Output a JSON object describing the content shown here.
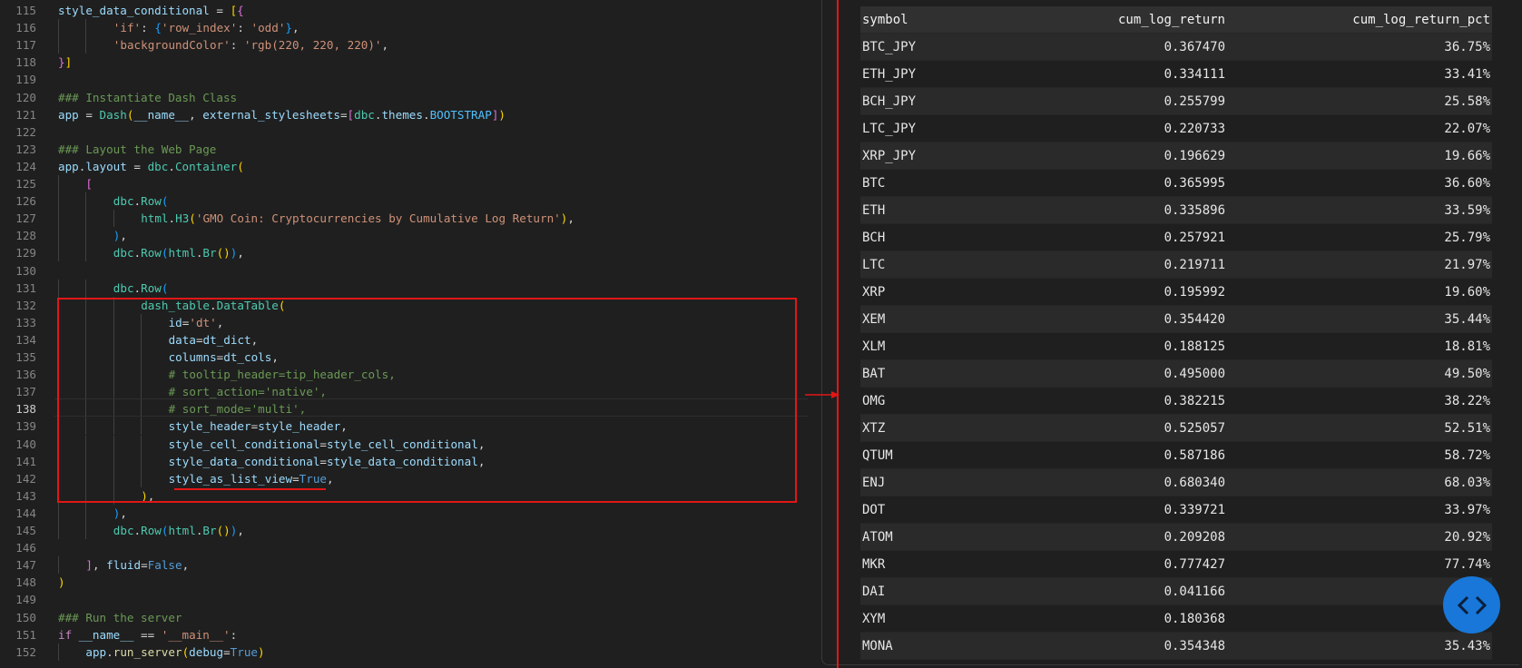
{
  "editor": {
    "lines": [
      {
        "n": "115",
        "tokens": [
          [
            "t-var",
            "style_data_conditional"
          ],
          [
            "t-op",
            " = "
          ],
          [
            "t-brk1",
            "["
          ],
          [
            "t-brk2",
            "{"
          ]
        ]
      },
      {
        "n": "116",
        "indent": 2,
        "tokens": [
          [
            "t-str",
            "'if'"
          ],
          [
            "t-op",
            ": "
          ],
          [
            "t-brk3",
            "{"
          ],
          [
            "t-str",
            "'row_index'"
          ],
          [
            "t-op",
            ": "
          ],
          [
            "t-str",
            "'odd'"
          ],
          [
            "t-brk3",
            "}"
          ],
          [
            "t-op",
            ","
          ]
        ]
      },
      {
        "n": "117",
        "indent": 2,
        "tokens": [
          [
            "t-str",
            "'backgroundColor'"
          ],
          [
            "t-op",
            ": "
          ],
          [
            "t-str",
            "'rgb(220, 220, 220)'"
          ],
          [
            "t-op",
            ","
          ]
        ]
      },
      {
        "n": "118",
        "tokens": [
          [
            "t-brk2",
            "}"
          ],
          [
            "t-brk1",
            "]"
          ]
        ]
      },
      {
        "n": "119",
        "tokens": []
      },
      {
        "n": "120",
        "tokens": [
          [
            "t-cmt",
            "### Instantiate Dash Class"
          ]
        ]
      },
      {
        "n": "121",
        "tokens": [
          [
            "t-var",
            "app"
          ],
          [
            "t-op",
            " = "
          ],
          [
            "t-cls",
            "Dash"
          ],
          [
            "t-brk1",
            "("
          ],
          [
            "t-var",
            "__name__"
          ],
          [
            "t-op",
            ", "
          ],
          [
            "t-var",
            "external_stylesheets"
          ],
          [
            "t-op",
            "="
          ],
          [
            "t-brk2",
            "["
          ],
          [
            "t-cls",
            "dbc"
          ],
          [
            "t-op",
            "."
          ],
          [
            "t-var",
            "themes"
          ],
          [
            "t-op",
            "."
          ],
          [
            "t-num",
            "BOOTSTRAP"
          ],
          [
            "t-brk2",
            "]"
          ],
          [
            "t-brk1",
            ")"
          ]
        ]
      },
      {
        "n": "122",
        "tokens": []
      },
      {
        "n": "123",
        "tokens": [
          [
            "t-cmt",
            "### Layout the Web Page"
          ]
        ]
      },
      {
        "n": "124",
        "tokens": [
          [
            "t-var",
            "app"
          ],
          [
            "t-op",
            "."
          ],
          [
            "t-var",
            "layout"
          ],
          [
            "t-op",
            " = "
          ],
          [
            "t-cls",
            "dbc"
          ],
          [
            "t-op",
            "."
          ],
          [
            "t-cls",
            "Container"
          ],
          [
            "t-brk1",
            "("
          ]
        ]
      },
      {
        "n": "125",
        "indent": 1,
        "tokens": [
          [
            "t-brk2",
            "["
          ]
        ]
      },
      {
        "n": "126",
        "indent": 2,
        "tokens": [
          [
            "t-cls",
            "dbc"
          ],
          [
            "t-op",
            "."
          ],
          [
            "t-cls",
            "Row"
          ],
          [
            "t-brk3",
            "("
          ]
        ]
      },
      {
        "n": "127",
        "indent": 3,
        "tokens": [
          [
            "t-cls",
            "html"
          ],
          [
            "t-op",
            "."
          ],
          [
            "t-cls",
            "H3"
          ],
          [
            "t-brk1",
            "("
          ],
          [
            "t-str",
            "'GMO Coin: Cryptocurrencies by Cumulative Log Return'"
          ],
          [
            "t-brk1",
            ")"
          ],
          [
            "t-op",
            ","
          ]
        ]
      },
      {
        "n": "128",
        "indent": 2,
        "tokens": [
          [
            "t-brk3",
            ")"
          ],
          [
            "t-op",
            ","
          ]
        ]
      },
      {
        "n": "129",
        "indent": 2,
        "tokens": [
          [
            "t-cls",
            "dbc"
          ],
          [
            "t-op",
            "."
          ],
          [
            "t-cls",
            "Row"
          ],
          [
            "t-brk3",
            "("
          ],
          [
            "t-cls",
            "html"
          ],
          [
            "t-op",
            "."
          ],
          [
            "t-cls",
            "Br"
          ],
          [
            "t-brk1",
            "()"
          ],
          [
            "t-brk3",
            ")"
          ],
          [
            "t-op",
            ","
          ]
        ]
      },
      {
        "n": "130",
        "tokens": []
      },
      {
        "n": "131",
        "indent": 2,
        "tokens": [
          [
            "t-cls",
            "dbc"
          ],
          [
            "t-op",
            "."
          ],
          [
            "t-cls",
            "Row"
          ],
          [
            "t-brk3",
            "("
          ]
        ]
      },
      {
        "n": "132",
        "indent": 3,
        "tokens": [
          [
            "t-cls",
            "dash_table"
          ],
          [
            "t-op",
            "."
          ],
          [
            "t-cls",
            "DataTable"
          ],
          [
            "t-brk1",
            "("
          ]
        ]
      },
      {
        "n": "133",
        "indent": 4,
        "tokens": [
          [
            "t-var",
            "id"
          ],
          [
            "t-op",
            "="
          ],
          [
            "t-str",
            "'dt'"
          ],
          [
            "t-op",
            ","
          ]
        ]
      },
      {
        "n": "134",
        "indent": 4,
        "tokens": [
          [
            "t-var",
            "data"
          ],
          [
            "t-op",
            "="
          ],
          [
            "t-var",
            "dt_dict"
          ],
          [
            "t-op",
            ","
          ]
        ]
      },
      {
        "n": "135",
        "indent": 4,
        "tokens": [
          [
            "t-var",
            "columns"
          ],
          [
            "t-op",
            "="
          ],
          [
            "t-var",
            "dt_cols"
          ],
          [
            "t-op",
            ","
          ]
        ]
      },
      {
        "n": "136",
        "indent": 4,
        "tokens": [
          [
            "t-cmt",
            "# tooltip_header=tip_header_cols,"
          ]
        ]
      },
      {
        "n": "137",
        "indent": 4,
        "tokens": [
          [
            "t-cmt",
            "# sort_action='native',"
          ]
        ]
      },
      {
        "n": "138",
        "indent": 4,
        "cur": true,
        "tokens": [
          [
            "t-cmt",
            "# sort_mode='multi',"
          ]
        ]
      },
      {
        "n": "139",
        "indent": 4,
        "tokens": [
          [
            "t-var",
            "style_header"
          ],
          [
            "t-op",
            "="
          ],
          [
            "t-var",
            "style_header"
          ],
          [
            "t-op",
            ","
          ]
        ]
      },
      {
        "n": "140",
        "indent": 4,
        "tokens": [
          [
            "t-var",
            "style_cell_conditional"
          ],
          [
            "t-op",
            "="
          ],
          [
            "t-var",
            "style_cell_conditional"
          ],
          [
            "t-op",
            ","
          ]
        ]
      },
      {
        "n": "141",
        "indent": 4,
        "tokens": [
          [
            "t-var",
            "style_data_conditional"
          ],
          [
            "t-op",
            "="
          ],
          [
            "t-var",
            "style_data_conditional"
          ],
          [
            "t-op",
            ","
          ]
        ]
      },
      {
        "n": "142",
        "indent": 4,
        "tokens": [
          [
            "t-var",
            "style_as_list_view"
          ],
          [
            "t-op",
            "="
          ],
          [
            "t-const",
            "True"
          ],
          [
            "t-op",
            ","
          ]
        ]
      },
      {
        "n": "143",
        "indent": 3,
        "tokens": [
          [
            "t-brk1",
            ")"
          ],
          [
            "t-op",
            ","
          ]
        ]
      },
      {
        "n": "144",
        "indent": 2,
        "tokens": [
          [
            "t-brk3",
            ")"
          ],
          [
            "t-op",
            ","
          ]
        ]
      },
      {
        "n": "145",
        "indent": 2,
        "tokens": [
          [
            "t-cls",
            "dbc"
          ],
          [
            "t-op",
            "."
          ],
          [
            "t-cls",
            "Row"
          ],
          [
            "t-brk3",
            "("
          ],
          [
            "t-cls",
            "html"
          ],
          [
            "t-op",
            "."
          ],
          [
            "t-cls",
            "Br"
          ],
          [
            "t-brk1",
            "()"
          ],
          [
            "t-brk3",
            ")"
          ],
          [
            "t-op",
            ","
          ]
        ]
      },
      {
        "n": "146",
        "tokens": []
      },
      {
        "n": "147",
        "indent": 1,
        "tokens": [
          [
            "t-brk2",
            "]"
          ],
          [
            "t-op",
            ", "
          ],
          [
            "t-var",
            "fluid"
          ],
          [
            "t-op",
            "="
          ],
          [
            "t-const",
            "False"
          ],
          [
            "t-op",
            ","
          ]
        ]
      },
      {
        "n": "148",
        "tokens": [
          [
            "t-brk1",
            ")"
          ]
        ]
      },
      {
        "n": "149",
        "tokens": []
      },
      {
        "n": "150",
        "tokens": [
          [
            "t-cmt",
            "### Run the server"
          ]
        ]
      },
      {
        "n": "151",
        "tokens": [
          [
            "t-kw",
            "if"
          ],
          [
            "t-op",
            " "
          ],
          [
            "t-var",
            "__name__"
          ],
          [
            "t-op",
            " == "
          ],
          [
            "t-str",
            "'__main__'"
          ],
          [
            "t-op",
            ":"
          ]
        ]
      },
      {
        "n": "152",
        "indent": 1,
        "tokens": [
          [
            "t-var",
            "app"
          ],
          [
            "t-op",
            "."
          ],
          [
            "t-fn",
            "run_server"
          ],
          [
            "t-brk1",
            "("
          ],
          [
            "t-var",
            "debug"
          ],
          [
            "t-op",
            "="
          ],
          [
            "t-const",
            "True"
          ],
          [
            "t-brk1",
            ")"
          ]
        ]
      }
    ]
  },
  "table": {
    "headers": [
      "symbol",
      "cum_log_return",
      "cum_log_return_pct"
    ],
    "rows": [
      [
        "BTC_JPY",
        "0.367470",
        "36.75%"
      ],
      [
        "ETH_JPY",
        "0.334111",
        "33.41%"
      ],
      [
        "BCH_JPY",
        "0.255799",
        "25.58%"
      ],
      [
        "LTC_JPY",
        "0.220733",
        "22.07%"
      ],
      [
        "XRP_JPY",
        "0.196629",
        "19.66%"
      ],
      [
        "BTC",
        "0.365995",
        "36.60%"
      ],
      [
        "ETH",
        "0.335896",
        "33.59%"
      ],
      [
        "BCH",
        "0.257921",
        "25.79%"
      ],
      [
        "LTC",
        "0.219711",
        "21.97%"
      ],
      [
        "XRP",
        "0.195992",
        "19.60%"
      ],
      [
        "XEM",
        "0.354420",
        "35.44%"
      ],
      [
        "XLM",
        "0.188125",
        "18.81%"
      ],
      [
        "BAT",
        "0.495000",
        "49.50%"
      ],
      [
        "OMG",
        "0.382215",
        "38.22%"
      ],
      [
        "XTZ",
        "0.525057",
        "52.51%"
      ],
      [
        "QTUM",
        "0.587186",
        "58.72%"
      ],
      [
        "ENJ",
        "0.680340",
        "68.03%"
      ],
      [
        "DOT",
        "0.339721",
        "33.97%"
      ],
      [
        "ATOM",
        "0.209208",
        "20.92%"
      ],
      [
        "MKR",
        "0.777427",
        "77.74%"
      ],
      [
        "DAI",
        "0.041166",
        ""
      ],
      [
        "XYM",
        "0.180368",
        ""
      ],
      [
        "MONA",
        "0.354348",
        "35.43%"
      ]
    ]
  },
  "fab": {
    "icon": "code-brackets-icon",
    "glyph": "< >"
  }
}
